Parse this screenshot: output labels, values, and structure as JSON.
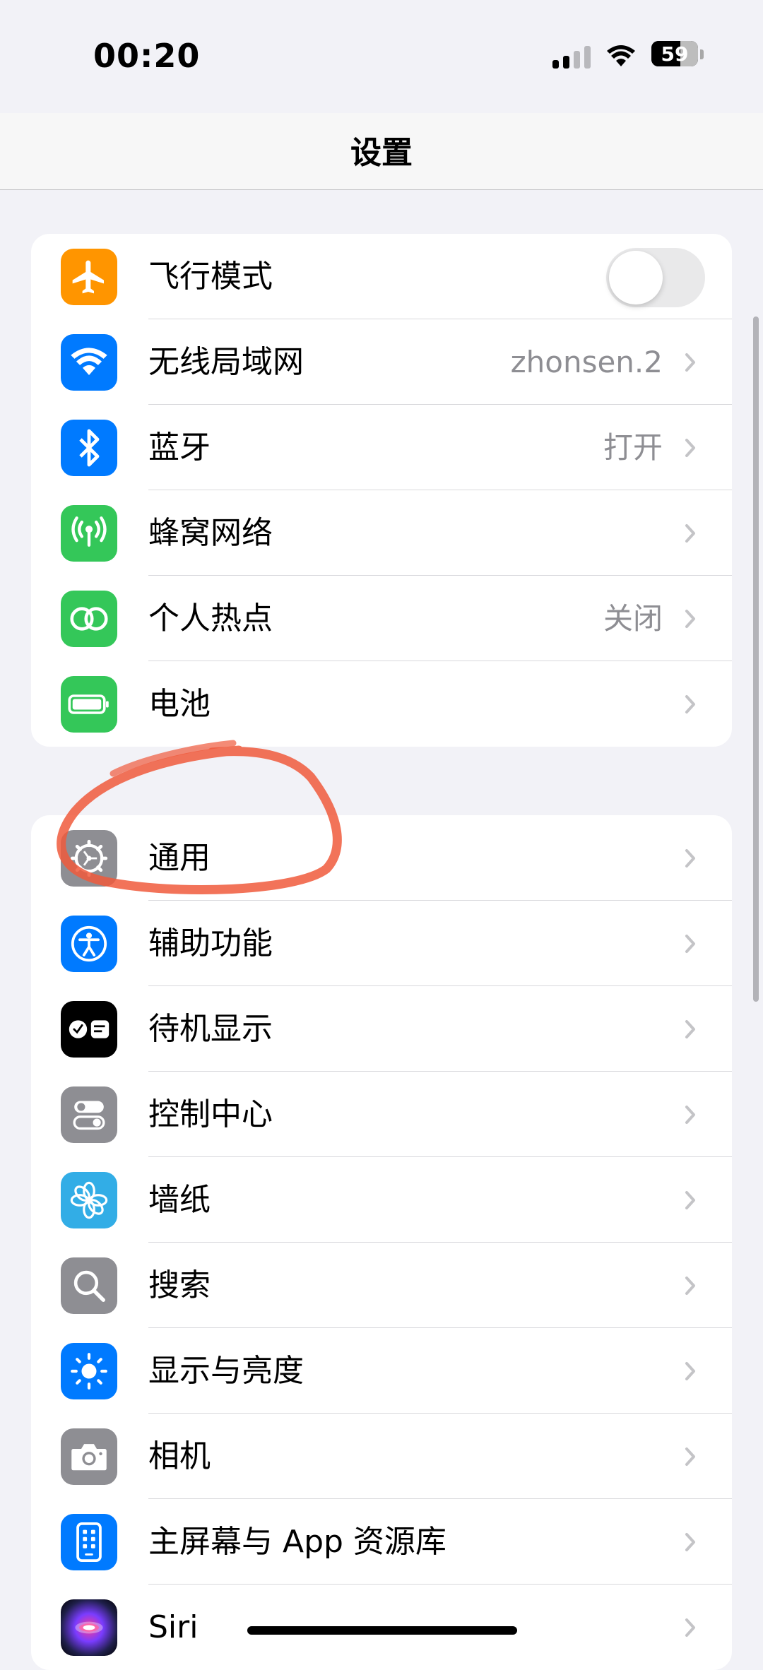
{
  "status_bar": {
    "time": "00:20",
    "battery": "59"
  },
  "nav": {
    "title": "设置"
  },
  "connectivity": [
    {
      "label": "飞行模式",
      "value": "",
      "icon": "airplane-icon",
      "color": "#FF9500",
      "toggle_on": false
    },
    {
      "label": "无线局域网",
      "value": "zhonsen.2",
      "icon": "wifi-icon",
      "color": "#007AFF"
    },
    {
      "label": "蓝牙",
      "value": "打开",
      "icon": "bluetooth-icon",
      "color": "#007AFF"
    },
    {
      "label": "蜂窝网络",
      "value": "",
      "icon": "cellular-icon",
      "color": "#34C759"
    },
    {
      "label": "个人热点",
      "value": "关闭",
      "icon": "hotspot-icon",
      "color": "#34C759"
    },
    {
      "label": "电池",
      "value": "",
      "icon": "battery-icon",
      "color": "#34C759"
    }
  ],
  "general": [
    {
      "label": "通用",
      "icon": "gear-icon",
      "color": "#8E8E93"
    },
    {
      "label": "辅助功能",
      "icon": "accessibility-icon",
      "color": "#007AFF"
    },
    {
      "label": "待机显示",
      "icon": "standby-icon",
      "color": "#000000"
    },
    {
      "label": "控制中心",
      "icon": "control-center-icon",
      "color": "#8E8E93"
    },
    {
      "label": "墙纸",
      "icon": "wallpaper-icon",
      "color": "#32ADE6"
    },
    {
      "label": "搜索",
      "icon": "search-icon",
      "color": "#8E8E93"
    },
    {
      "label": "显示与亮度",
      "icon": "brightness-icon",
      "color": "#007AFF"
    },
    {
      "label": "相机",
      "icon": "camera-icon",
      "color": "#8E8E93"
    },
    {
      "label": "主屏幕与 App 资源库",
      "icon": "home-screen-icon",
      "color": "#007AFF"
    },
    {
      "label": "Siri",
      "icon": "siri-icon",
      "color": "#2a2a6a"
    }
  ],
  "annotation": {
    "color": "#F05A3C"
  }
}
